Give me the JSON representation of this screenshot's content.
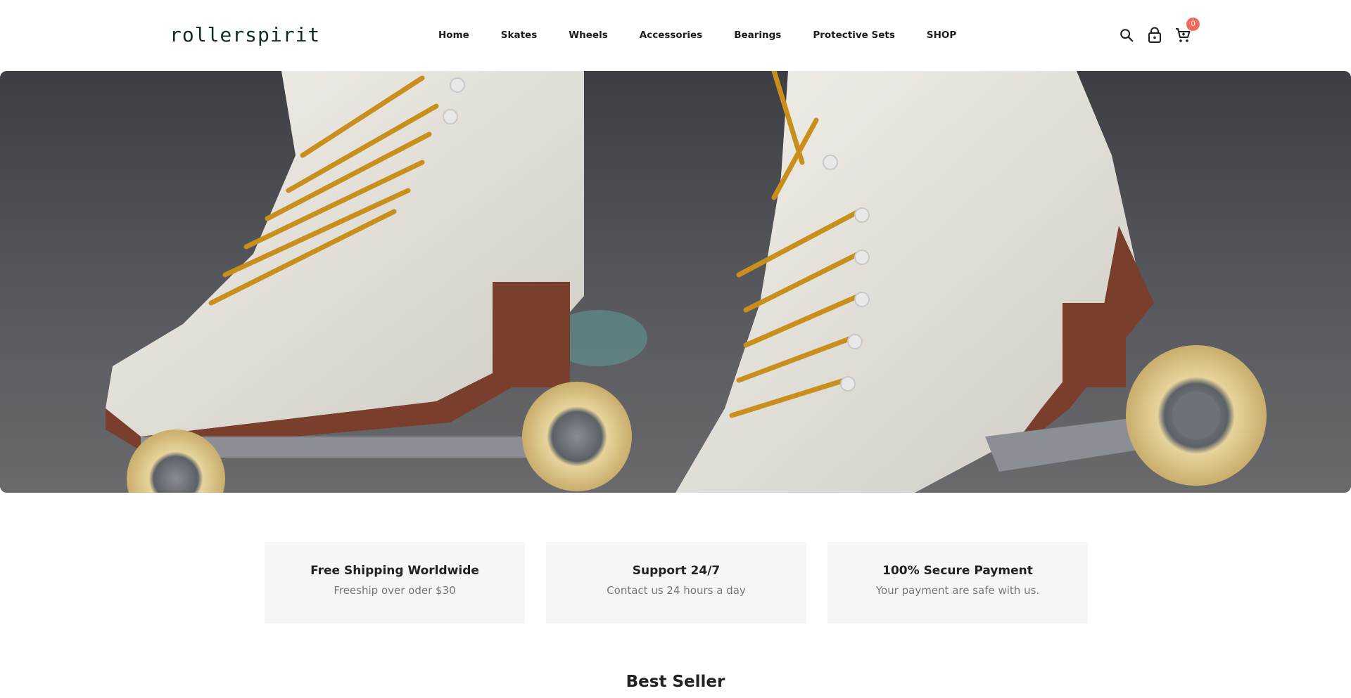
{
  "brand": {
    "logo_text": "rollerspirit"
  },
  "nav": {
    "items": [
      {
        "label": "Home"
      },
      {
        "label": "Skates"
      },
      {
        "label": "Wheels"
      },
      {
        "label": "Accessories"
      },
      {
        "label": "Bearings"
      },
      {
        "label": "Protective Sets"
      },
      {
        "label": "SHOP"
      }
    ]
  },
  "header_icons": {
    "search": "search-icon",
    "account": "lock-bag-icon",
    "cart": "cart-icon",
    "cart_count": "0"
  },
  "hero": {
    "image": "roller-skates-photo"
  },
  "features": [
    {
      "title": "Free Shipping Worldwide",
      "subtitle": "Freeship over oder $30"
    },
    {
      "title": "Support 24/7",
      "subtitle": "Contact us 24 hours a day"
    },
    {
      "title": "100% Secure Payment",
      "subtitle": "Your payment are safe with us."
    }
  ],
  "sections": {
    "best_seller_title": "Best Seller"
  },
  "colors": {
    "badge": "#ef6b5c",
    "logo": "#0f2d27",
    "feature_bg": "#f5f6f7"
  }
}
